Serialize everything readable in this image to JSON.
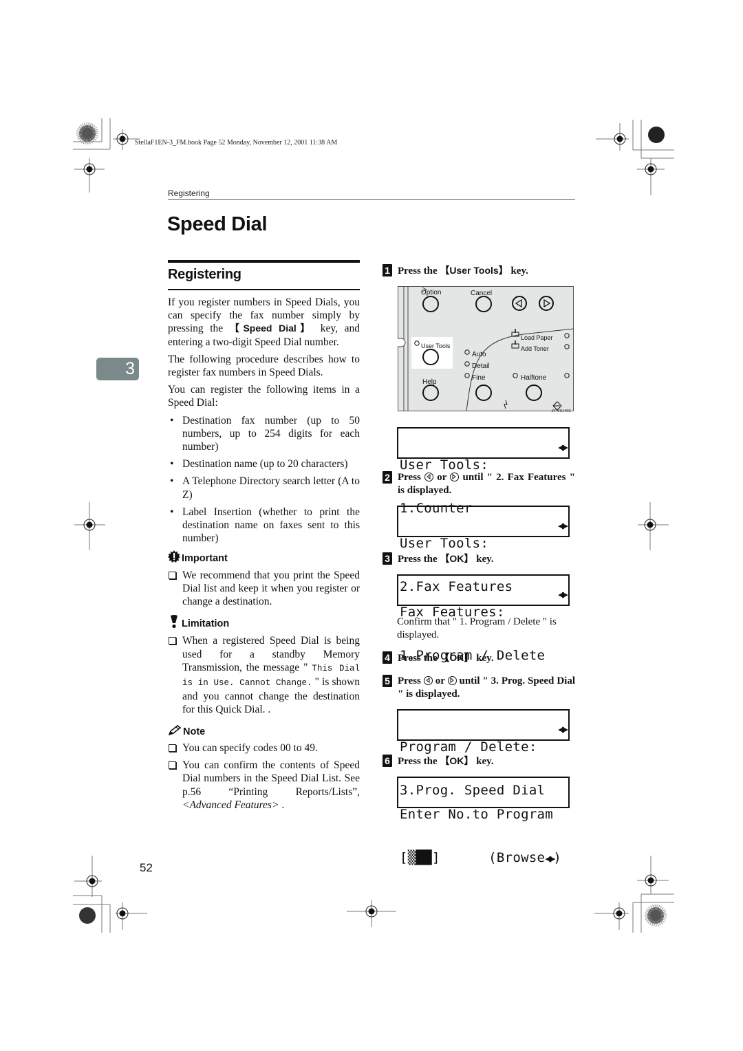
{
  "book_info": "StellaF1EN-3_FM.book  Page 52  Monday, November 12, 2001  11:38 AM",
  "running_head": "Registering",
  "page_title": "Speed Dial",
  "section_title": "Registering",
  "chapter_tab": "3",
  "page_number": "52",
  "left_column": {
    "intro_1_pre": "If you register numbers in Speed Dials, you can specify the fax number simply by pressing the ",
    "intro_1_key": "【Speed Dial】",
    "intro_1_post": " key, and entering a two-digit Speed Dial number.",
    "intro_2": "The following procedure describes how to register fax numbers in Speed Dials.",
    "intro_3": "You can register the following items in a Speed Dial:",
    "bullets": [
      "Destination fax number (up to 50 numbers, up to 254 digits for each number)",
      "Destination name (up to 20 characters)",
      "A Telephone Directory search letter (A to Z)",
      "Label Insertion (whether to print the destination name on faxes sent to this number)"
    ],
    "important": {
      "heading": "Important",
      "items": [
        "We recommend that you print the Speed Dial list and keep it when you register or change a destination."
      ]
    },
    "limitation": {
      "heading": "Limitation",
      "text_pre": "When a registered Speed Dial is being used for a standby Memory Transmission, the message \" ",
      "message": "This Dial is in Use. Cannot Change.",
      "text_post": " \" is shown and you cannot change the destination for this Quick Dial. ."
    },
    "note": {
      "heading": "Note",
      "item_1": "You can specify codes 00 to 49.",
      "item_2_pre": "You can confirm the contents of Speed Dial numbers in the Speed Dial List. See p.56 “Printing Reports/Lists”, ",
      "item_2_ref": "<Advanced Features>",
      "item_2_post": " ."
    }
  },
  "steps": [
    {
      "num": "1",
      "pre": "Press the ",
      "key": "【User Tools】",
      "post": " key."
    },
    {
      "num": "2",
      "pre": "Press ",
      "mid": " or ",
      "post": " until \" 2. Fax Features \" is displayed."
    },
    {
      "num": "3",
      "pre": "Press the ",
      "key": "【OK】",
      "post": " key."
    },
    {
      "num": "4",
      "pre": "Press the ",
      "key": "【OK】",
      "post": " key."
    },
    {
      "num": "5",
      "pre": "Press ",
      "mid": " or ",
      "post": " until \" 3. Prog. Speed Dial \" is displayed."
    },
    {
      "num": "6",
      "pre": "Press the ",
      "key": "【OK】",
      "post": " key."
    }
  ],
  "confirm_text": "Confirm that \" 1. Program / Delete \" is displayed.",
  "lcd_screens": [
    {
      "line1": "User Tools:",
      "line2": "1.Counter"
    },
    {
      "line1": "User Tools:",
      "line2": "2.Fax Features"
    },
    {
      "line1": "Fax Features:",
      "line2": "1.Program / Delete"
    },
    {
      "line1": "Program / Delete:",
      "line2": "3.Prog. Speed Dial"
    },
    {
      "line1": "Enter No.to Program",
      "line2": "[▒██]      (Browse"
    }
  ],
  "lcd_arrows": "◀▶",
  "control_panel": {
    "labels": {
      "option": "Option",
      "cancel": "Cancel",
      "user_tools": "User Tools",
      "help": "Help",
      "auto": "Auto",
      "detail": "Detail",
      "fine": "Fine",
      "halftone": "Halftone",
      "load_paper": "Load Paper",
      "add_toner": "Add Toner"
    },
    "figure_code": "ZFWS140E"
  },
  "colors": {
    "chapter_tab": "#7a8a8a",
    "panel_bg": "#e4e6e6",
    "text": "#111111"
  }
}
